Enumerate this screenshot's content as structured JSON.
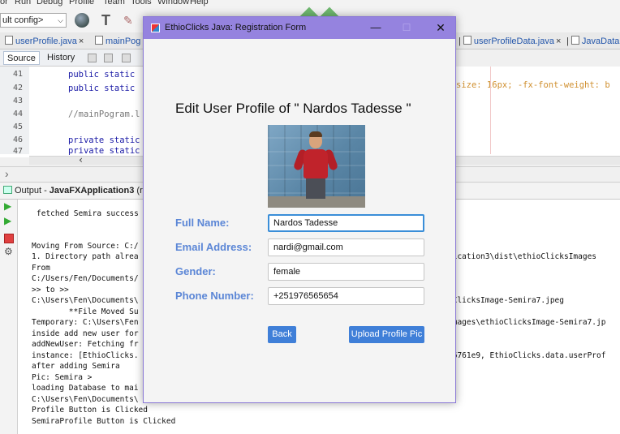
{
  "ide": {
    "menu": [
      "or",
      "Run",
      "Debug",
      "Profile",
      "Team",
      "Tools",
      "Window",
      "Help"
    ],
    "config_select": "ult config>",
    "file_tabs": [
      {
        "label": "userProfile.java",
        "close": "×"
      },
      {
        "label": "mainPog"
      },
      {
        "label": "userProfileData.java",
        "close": "×"
      },
      {
        "label": "JavaData"
      }
    ],
    "source_tab": "Source",
    "history_tab": "History",
    "line_numbers": [
      "41",
      "42",
      "43",
      "44",
      "45",
      "46",
      "47"
    ],
    "code_lines": [
      "public static",
      "public static",
      "",
      "//mainPogram.l",
      "",
      "private static",
      "private static"
    ],
    "code_right": "size: 16px; -fx-font-weight: b",
    "output_tab_prefix": "Output - ",
    "output_tab_name": "JavaFXApplication3",
    "output_tab_suffix": " (run",
    "output_lines": [
      "fetched Semira success",
      "",
      "Moving From Source: C:/",
      "1. Directory path alrea",
      "From",
      "C:/Users/Fen/Documents/",
      ">> to >>",
      "C:\\Users\\Fen\\Documents\\",
      "        **File Moved Su",
      "Temporary: C:\\Users\\Fen",
      "inside add new user for",
      "addNewUser: Fetching fr",
      "instance: [EthioClicks.",
      "after adding Semira",
      "Pic: Semira >",
      "loading Database to mai",
      "C:\\Users\\Fen\\Documents\\",
      "Profile Button is Clicked",
      "SemiraProfile Button is Clicked"
    ],
    "output_right_lines": [
      {
        "row": 4,
        "text": "lication3\\dist\\ethioClicksImages"
      },
      {
        "row": 9,
        "text": "oClicksImage-Semira7.jpeg"
      },
      {
        "row": 11,
        "text": "Images\\ethioClicksImage-Semira7.jp"
      },
      {
        "row": 14,
        "text": "76761e9, EthioClicks.data.userProf"
      }
    ]
  },
  "dialog": {
    "title": "EthioClicks Java: Registration Form",
    "minimize": "—",
    "maximize": "☐",
    "close": "✕",
    "heading": "Edit User Profile of \" Nardos Tadesse \"",
    "fields": {
      "full_name": {
        "label": "Full Name:",
        "value": "Nardos Tadesse"
      },
      "email": {
        "label": "Email Address:",
        "value": "nardi@gmail.com"
      },
      "gender": {
        "label": "Gender:",
        "value": "female"
      },
      "phone": {
        "label": "Phone Number:",
        "value": "+251976565654"
      }
    },
    "back_button": "Back",
    "upload_button": "Upload Profile Pic"
  },
  "colors": {
    "title_bar": "#9583df",
    "label": "#5b86d6",
    "button": "#3f7fd8",
    "focus": "#3a8ed8"
  }
}
